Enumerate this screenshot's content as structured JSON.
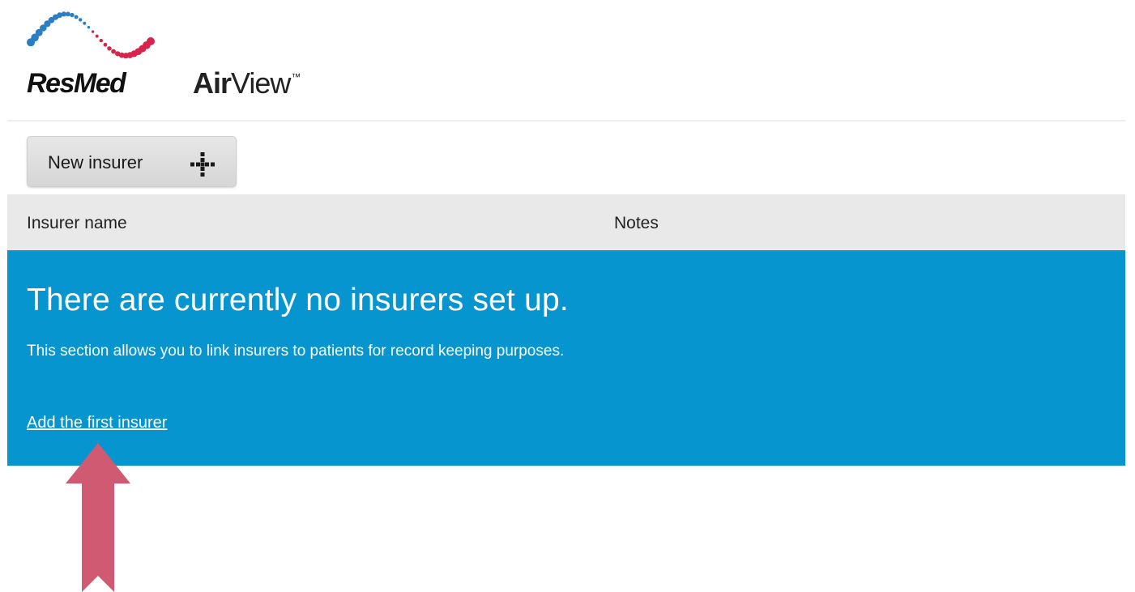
{
  "header": {
    "brand": "ResMed",
    "product_air": "Air",
    "product_view": "View",
    "product_tm": "™"
  },
  "toolbar": {
    "new_insurer_label": "New insurer",
    "new_insurer_icon": "plus-icon"
  },
  "table": {
    "columns": [
      "Insurer name",
      "Notes"
    ]
  },
  "empty_state": {
    "title": "There are currently no insurers set up.",
    "description": "This section allows you to link insurers to patients for record keeping purposes.",
    "link": "Add the first insurer"
  },
  "colors": {
    "panel": "#0795d0",
    "header_bg": "#e9e9e9",
    "arrow": "#d05a72",
    "wave_blue": "#2a7fc4",
    "wave_red": "#d8234a"
  },
  "annotation": {
    "icon": "up-arrow-icon"
  }
}
